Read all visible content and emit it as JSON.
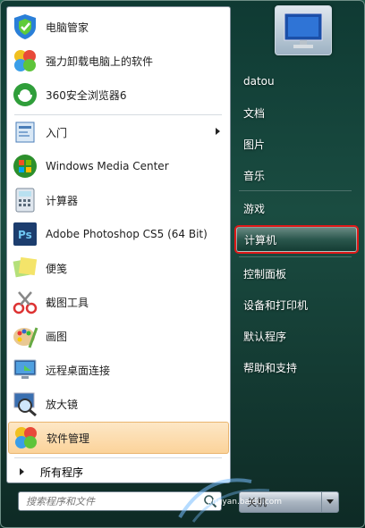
{
  "start_menu": {
    "programs": [
      {
        "label": "电脑管家",
        "icon": "pc-manager-icon"
      },
      {
        "label": "强力卸载电脑上的软件",
        "icon": "uninstaller-icon"
      },
      {
        "label": "360安全浏览器6",
        "icon": "browser-360-icon"
      },
      {
        "label": "入门",
        "icon": "getting-started-icon",
        "has_submenu": true
      },
      {
        "label": "Windows Media Center",
        "icon": "media-center-icon"
      },
      {
        "label": "计算器",
        "icon": "calculator-icon"
      },
      {
        "label": "Adobe Photoshop CS5 (64 Bit)",
        "icon": "photoshop-icon"
      },
      {
        "label": "便笺",
        "icon": "sticky-notes-icon"
      },
      {
        "label": "截图工具",
        "icon": "snipping-tool-icon"
      },
      {
        "label": "画图",
        "icon": "paint-icon"
      },
      {
        "label": "远程桌面连接",
        "icon": "remote-desktop-icon"
      },
      {
        "label": "放大镜",
        "icon": "magnifier-icon"
      },
      {
        "label": "软件管理",
        "icon": "software-manager-icon",
        "selected": true
      }
    ],
    "all_programs_label": "所有程序",
    "search": {
      "placeholder": "搜索程序和文件"
    },
    "right_items": [
      {
        "label": "datou"
      },
      {
        "label": "文档"
      },
      {
        "label": "图片"
      },
      {
        "label": "音乐"
      },
      {
        "label": "游戏"
      },
      {
        "label": "计算机",
        "highlighted": true
      },
      {
        "label": "控制面板"
      },
      {
        "label": "设备和打印机"
      },
      {
        "label": "默认程序"
      },
      {
        "label": "帮助和支持"
      }
    ],
    "shutdown_label": "关机",
    "watermark": "jingyan.baidu.com",
    "colors": {
      "highlight_box": "#e01818",
      "selected_item": "#fbd39a"
    }
  }
}
